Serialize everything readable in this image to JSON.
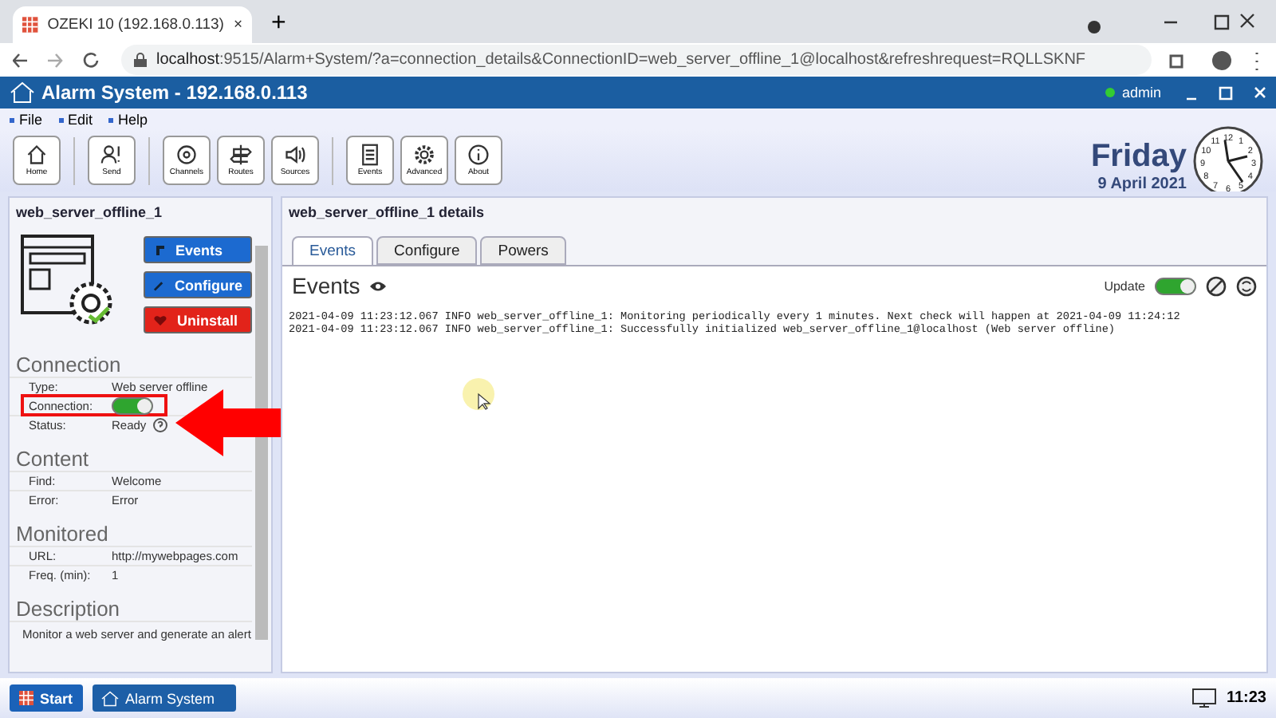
{
  "browser": {
    "tab_title": "OZEKI 10 (192.168.0.113)",
    "tab_close": "×",
    "new_tab": "+",
    "url_host": "localhost",
    "url_rest": ":9515/Alarm+System/?a=connection_details&ConnectionID=web_server_offline_1@localhost&refreshrequest=RQLLSKNF"
  },
  "app": {
    "title": "Alarm System - 192.168.0.113",
    "user": "admin"
  },
  "menu": [
    "File",
    "Edit",
    "Help"
  ],
  "toolbar_groups": [
    [
      {
        "label": "Home",
        "kind": "home"
      }
    ],
    [
      {
        "label": "Send",
        "kind": "send"
      }
    ],
    [
      {
        "label": "Channels",
        "kind": "channels"
      },
      {
        "label": "Routes",
        "kind": "routes"
      },
      {
        "label": "Sources",
        "kind": "sources"
      }
    ],
    [
      {
        "label": "Events",
        "kind": "events"
      },
      {
        "label": "Advanced",
        "kind": "advanced"
      },
      {
        "label": "About",
        "kind": "about"
      }
    ]
  ],
  "date": {
    "day": "Friday",
    "date": "9 April 2021",
    "clock_numbers": [
      "11",
      "12",
      "1",
      "10",
      "2",
      "9",
      "3",
      "8",
      "4",
      "7",
      "6",
      "5"
    ]
  },
  "left": {
    "title": "web_server_offline_1",
    "actions": [
      {
        "label": "Events",
        "kind": "events"
      },
      {
        "label": "Configure",
        "kind": "configure"
      },
      {
        "label": "Uninstall",
        "kind": "uninstall"
      }
    ],
    "sections": [
      {
        "title": "Connection",
        "rows": [
          {
            "label": "Type:",
            "kind": "text",
            "value": "Web server offline"
          },
          {
            "label": "Connection:",
            "kind": "toggle",
            "on": true,
            "highlighted": true
          },
          {
            "label": "Status:",
            "kind": "status",
            "value": "Ready"
          }
        ]
      },
      {
        "title": "Content",
        "rows": [
          {
            "label": "Find:",
            "kind": "text",
            "value": "Welcome"
          },
          {
            "label": "Error:",
            "kind": "text",
            "value": "Error"
          }
        ]
      },
      {
        "title": "Monitored",
        "rows": [
          {
            "label": "URL:",
            "kind": "text",
            "value": "http://mywebpages.com"
          },
          {
            "label": "Freq. (min):",
            "kind": "text",
            "value": "1"
          }
        ]
      },
      {
        "title": "Description",
        "text": "Monitor a web server and generate an alert"
      }
    ]
  },
  "right": {
    "title": "web_server_offline_1 details",
    "tabs": [
      {
        "label": "Events",
        "selected": true
      },
      {
        "label": "Configure",
        "selected": false
      },
      {
        "label": "Powers",
        "selected": false
      }
    ],
    "heading": "Events",
    "update_label": "Update",
    "update_on": true,
    "log": [
      "2021-04-09 11:23:12.067 INFO web_server_offline_1: Monitoring periodically every 1 minutes. Next check will happen at 2021-04-09 11:24:12",
      "2021-04-09 11:23:12.067 INFO web_server_offline_1: Successfully initialized web_server_offline_1@localhost (Web server offline)"
    ]
  },
  "taskbar": {
    "start": "Start",
    "apps": [
      "Alarm System"
    ],
    "time": "11:23"
  }
}
